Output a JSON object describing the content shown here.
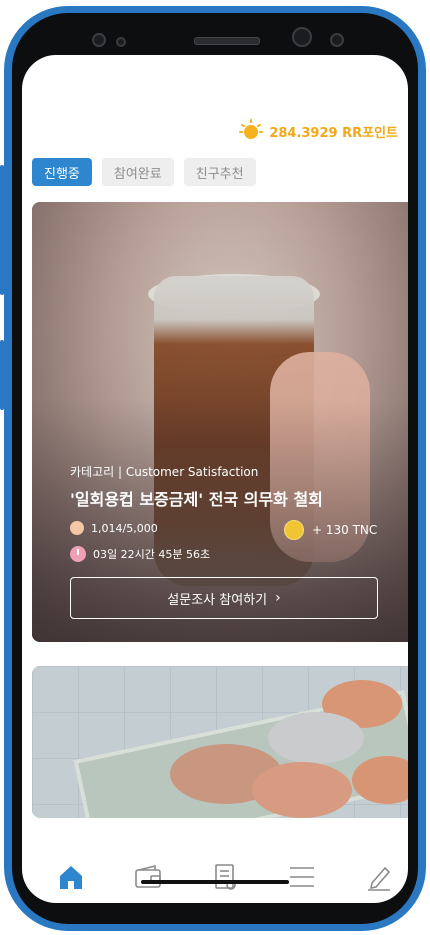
{
  "header": {
    "points_text": "284.3929 RR포인트"
  },
  "tabs": [
    {
      "label": "진행중"
    },
    {
      "label": "참여완료"
    },
    {
      "label": "친구추천"
    }
  ],
  "survey_card": {
    "category": "카테고리 | Customer Satisfaction",
    "title": "'일회용컵 보증금제' 전국 의무화 철회",
    "participants": "1,014/5,000",
    "reward": "+ 130 TNC",
    "time_left": "03일 22시간 45분 56초",
    "cta_label": "설문조사 참여하기"
  },
  "bottom_nav": [
    {
      "name": "home-icon"
    },
    {
      "name": "wallet-icon"
    },
    {
      "name": "survey-icon"
    },
    {
      "name": "menu-icon"
    },
    {
      "name": "edit-icon"
    }
  ],
  "colors": {
    "accent": "#2e86cf",
    "points": "#f2a81a",
    "frame": "#2b78c2"
  }
}
